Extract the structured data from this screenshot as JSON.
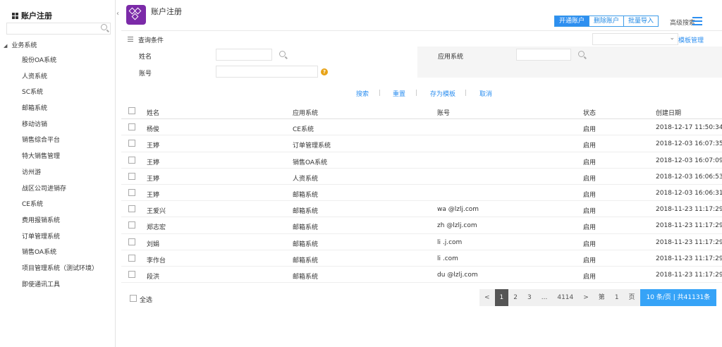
{
  "sidebar": {
    "title": "账户注册",
    "root": "业务系统",
    "items": [
      "股份OA系统",
      "人资系统",
      "SC系统",
      "邮箱系统",
      "移动访销",
      "销售综合平台",
      "特大销售管理",
      "访州游",
      "战区公司进销存",
      "CE系统",
      "费用报销系统",
      "订单管理系统",
      "销售OA系统",
      "项目管理系统（测试环境）",
      "即使通讯工具"
    ]
  },
  "header": {
    "title": "账户注册",
    "buttons": [
      "开通账户",
      "删除账户",
      "批量导入"
    ],
    "adv_search": "高级搜索"
  },
  "conditions": {
    "label": "查询条件",
    "template_manage": "模板管理"
  },
  "filter": {
    "name_label": "姓名",
    "account_label": "账号",
    "system_label": "应用系统"
  },
  "actions": [
    "搜索",
    "重置",
    "存为模板",
    "取消"
  ],
  "table": {
    "headers": [
      "姓名",
      "应用系统",
      "账号",
      "状态",
      "创建日期"
    ],
    "rows": [
      [
        "杨俊",
        "CE系统",
        "",
        "启用",
        "2018-12-17 11:50:34"
      ],
      [
        "王婷",
        "订单管理系统",
        "",
        "启用",
        "2018-12-03 16:07:35"
      ],
      [
        "王婷",
        "销售OA系统",
        "",
        "启用",
        "2018-12-03 16:07:09"
      ],
      [
        "王婷",
        "人资系统",
        "",
        "启用",
        "2018-12-03 16:06:53"
      ],
      [
        "王婷",
        "邮箱系统",
        "",
        "启用",
        "2018-12-03 16:06:31"
      ],
      [
        "王爱兴",
        "邮箱系统",
        "wa @lzlj.com",
        "启用",
        "2018-11-23 11:17:29"
      ],
      [
        "郑志宏",
        "邮箱系统",
        "zh @lzlj.com",
        "启用",
        "2018-11-23 11:17:29"
      ],
      [
        "刘娟",
        "邮箱系统",
        "li .j.com",
        "启用",
        "2018-11-23 11:17:29"
      ],
      [
        "李作台",
        "邮箱系统",
        "li .com",
        "启用",
        "2018-11-23 11:17:29"
      ],
      [
        "段洪",
        "邮箱系统",
        "du @lzlj.com",
        "启用",
        "2018-11-23 11:17:29"
      ]
    ]
  },
  "footer": {
    "select_all": "全选",
    "pager": [
      "<",
      "1",
      "2",
      "3",
      "...",
      "4114",
      ">",
      "第",
      "1",
      "页"
    ],
    "info": "10 条/页 | 共41131条"
  }
}
